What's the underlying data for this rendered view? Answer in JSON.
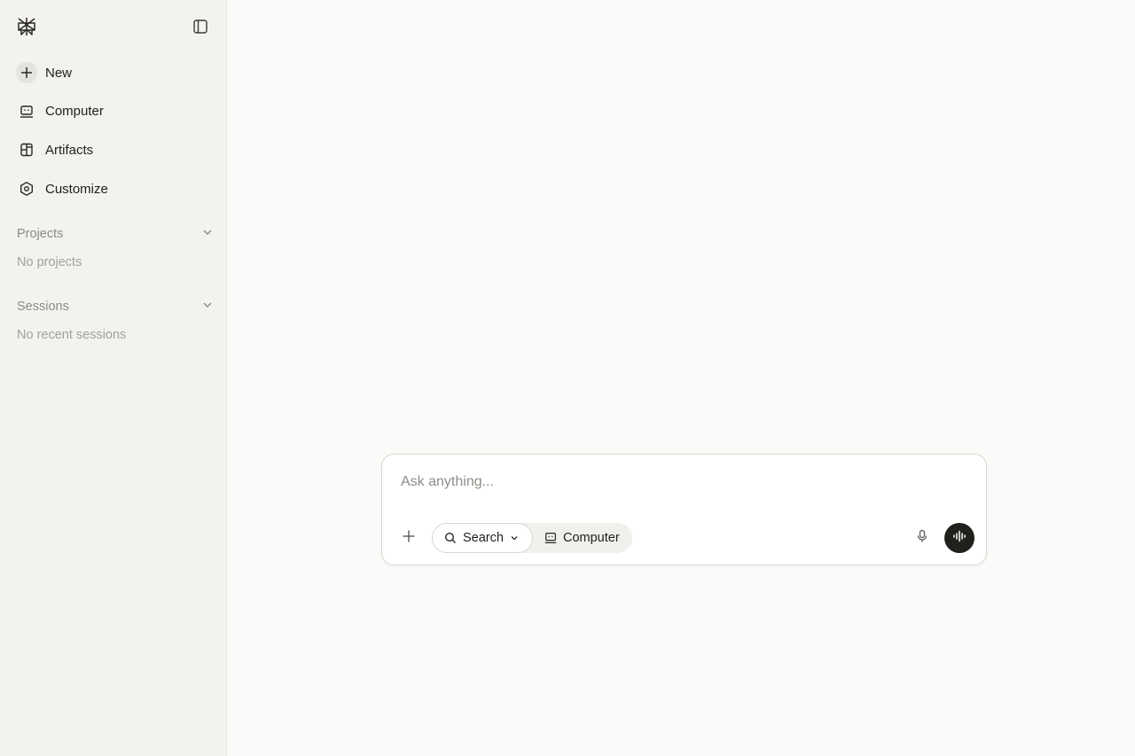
{
  "sidebar": {
    "logo": "perplexity-logo",
    "collapse_icon": "sidebar-toggle-icon",
    "items": [
      {
        "label": "New",
        "icon": "plus-icon"
      },
      {
        "label": "Computer",
        "icon": "computer-icon"
      },
      {
        "label": "Artifacts",
        "icon": "artifacts-icon"
      },
      {
        "label": "Customize",
        "icon": "customize-icon"
      }
    ],
    "projects": {
      "title": "Projects",
      "empty": "No projects"
    },
    "sessions": {
      "title": "Sessions",
      "empty": "No recent sessions"
    }
  },
  "composer": {
    "placeholder": "Ask anything...",
    "search_label": "Search",
    "computer_label": "Computer"
  },
  "colors": {
    "sidebar_bg": "#f3f2ef",
    "main_bg": "#fbfaf8",
    "voice_button": "#22201d"
  }
}
